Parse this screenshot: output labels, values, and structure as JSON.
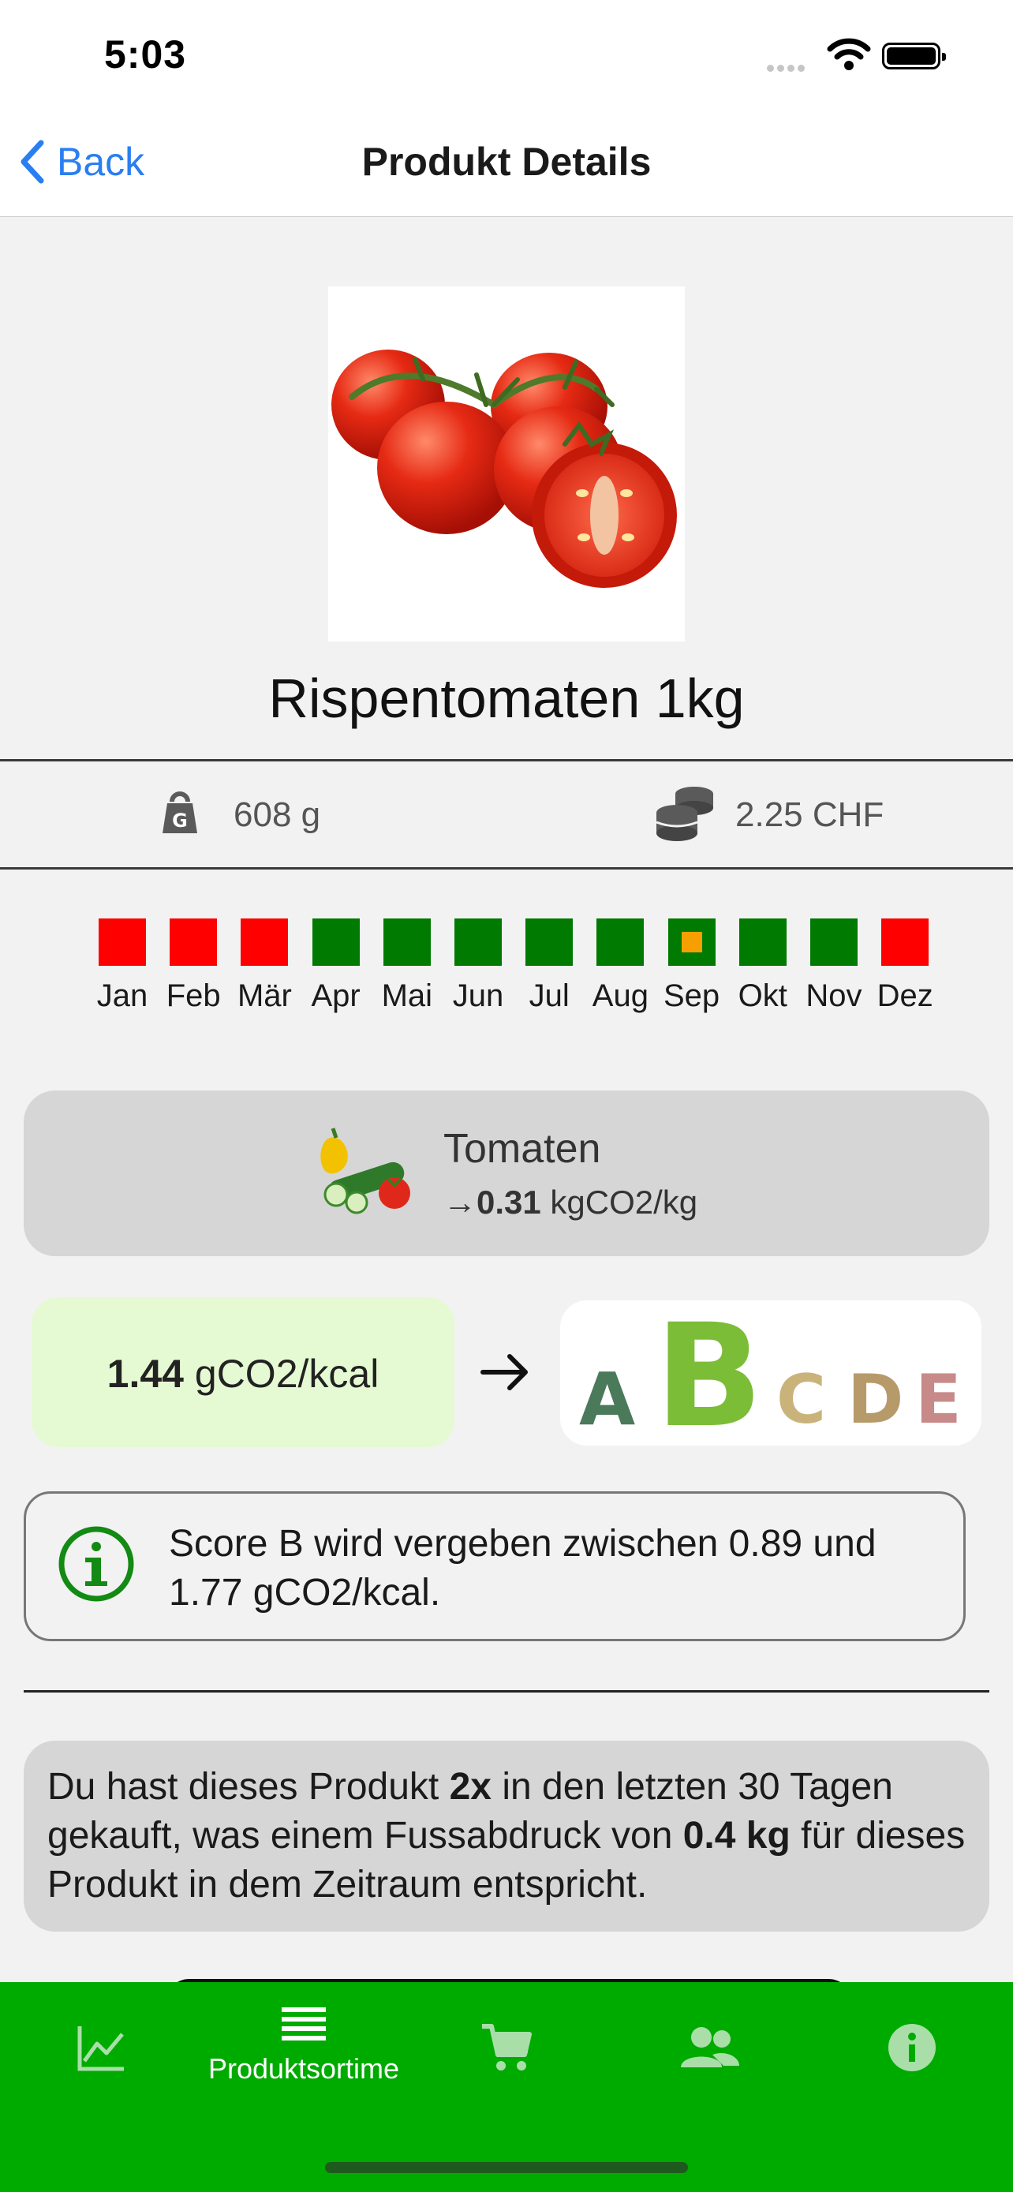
{
  "status": {
    "time": "5:03"
  },
  "nav": {
    "back_label": "Back",
    "title": "Produkt Details"
  },
  "product": {
    "name": "Rispentomaten 1kg",
    "weight": "608 g",
    "price": "2.25 CHF"
  },
  "seasons": [
    {
      "label": "Jan",
      "color": "#ff0000"
    },
    {
      "label": "Feb",
      "color": "#ff0000"
    },
    {
      "label": "Mär",
      "color": "#ff0000"
    },
    {
      "label": "Apr",
      "color": "#007a00"
    },
    {
      "label": "Mai",
      "color": "#007a00"
    },
    {
      "label": "Jun",
      "color": "#007a00"
    },
    {
      "label": "Jul",
      "color": "#007a00"
    },
    {
      "label": "Aug",
      "color": "#007a00"
    },
    {
      "label": "Sep",
      "color": "#007a00",
      "inner": "#f5a000"
    },
    {
      "label": "Okt",
      "color": "#007a00"
    },
    {
      "label": "Nov",
      "color": "#007a00"
    },
    {
      "label": "Dez",
      "color": "#ff0000"
    }
  ],
  "category": {
    "name": "Tomaten",
    "arrow": "→",
    "value": "0.31",
    "unit": "kgCO2/kg"
  },
  "score": {
    "value": "1.44",
    "unit": "gCO2/kcal",
    "letters": [
      "A",
      "B",
      "C",
      "D",
      "E"
    ],
    "active": "B",
    "info": "Score B wird vergeben zwischen 0.89 und 1.77 gCO2/kcal."
  },
  "purchase": {
    "part1": "Du hast dieses Produkt ",
    "count": "2x",
    "part2": " in den letzten 30 Tagen gekauft, was einem Fussabdruck von ",
    "footprint": "0.4 kg",
    "part3": " für dieses Produkt in dem Zeitraum entspricht."
  },
  "tabs": [
    {
      "icon": "chart-icon",
      "label": ""
    },
    {
      "icon": "list-icon",
      "label": "Produktsortime"
    },
    {
      "icon": "cart-icon",
      "label": ""
    },
    {
      "icon": "people-icon",
      "label": ""
    },
    {
      "icon": "info-icon",
      "label": ""
    }
  ],
  "colors": {
    "tabbar": "#00ab00",
    "accent": "#2a7ef2",
    "scoreB": "#7cbd37"
  }
}
